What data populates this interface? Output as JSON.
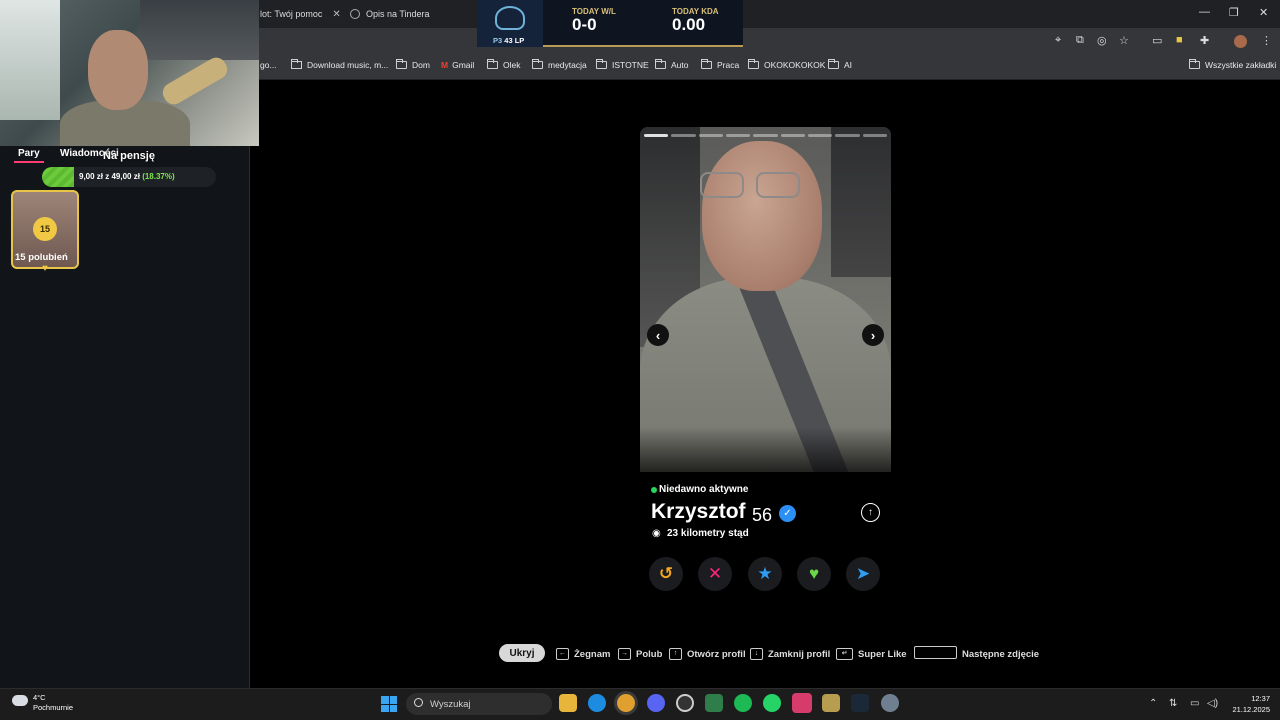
{
  "browser": {
    "tabs": [
      {
        "label": "lot: Twój pomoc"
      },
      {
        "label": "Opis na Tindera"
      }
    ],
    "window_controls": {
      "minimize": "—",
      "restore": "❐",
      "close": "✕"
    },
    "bookmarks": [
      "go...",
      "Download music, m...",
      "Dom",
      "Gmail",
      "Olek",
      "medytacja",
      "ISTOTNE",
      "Auto",
      "Praca",
      "OKOKOKOKOK",
      "AI"
    ],
    "all_bookmarks": "Wszystkie zakładki"
  },
  "lol_overlay": {
    "rank_prefix": "P3",
    "rank_lp": "43 LP",
    "wl_label": "TODAY W/L",
    "wl_value": "0-0",
    "kda_label": "TODAY KDA",
    "kda_value": "0.00"
  },
  "sidebar": {
    "tab_matches": "Pary",
    "tab_messages": "Wiadomości",
    "donation_goal_title": "Na pensję",
    "donation_current": "9,00 zł",
    "donation_sep": "z",
    "donation_target": "49,00 zł",
    "donation_percent": "(18.37%)",
    "donation_progress": 0.1837,
    "likes_count": "15",
    "likes_label": "15 polubień"
  },
  "profile": {
    "activity": "Niedawno aktywne",
    "name": "Krzysztof",
    "age": "56",
    "distance": "23 kilometry stąd",
    "photo_count": 9,
    "current_photo": 1,
    "actions": [
      {
        "name": "rewind",
        "glyph": "↺",
        "color": "#f5a623"
      },
      {
        "name": "nope",
        "glyph": "✕",
        "color": "#fd267d"
      },
      {
        "name": "super-like",
        "glyph": "★",
        "color": "#2e9cf2"
      },
      {
        "name": "like",
        "glyph": "♥",
        "color": "#6bd64a"
      },
      {
        "name": "boost",
        "glyph": "➤",
        "color": "#2e9cf2"
      }
    ]
  },
  "hints": {
    "hide": "Ukryj",
    "nope": "Żegnam",
    "like": "Polub",
    "open_profile": "Otwórz profil",
    "close_profile": "Zamknij profil",
    "super_like": "Super Like",
    "next_photo": "Następne zdjęcie"
  },
  "taskbar": {
    "weather_temp": "4°C",
    "weather_desc": "Pochmurnie",
    "search_placeholder": "Wyszukaj",
    "time": "12:37",
    "date": "21.12.2025"
  }
}
